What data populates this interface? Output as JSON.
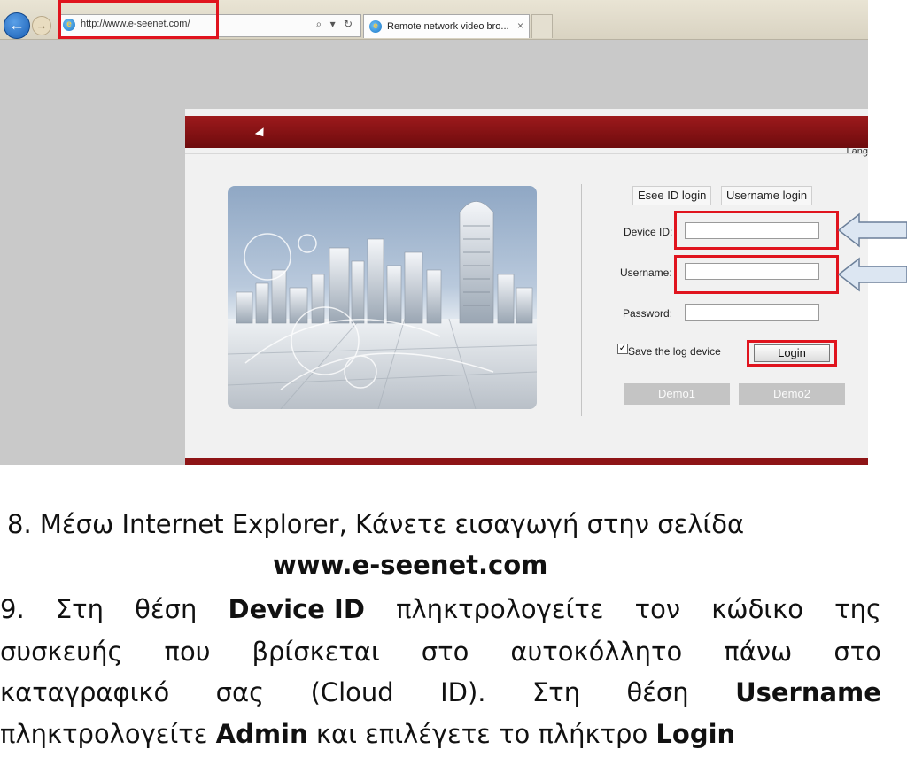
{
  "browser": {
    "url": "http://www.e-seenet.com/",
    "tab_title": "Remote network video bro...",
    "tab_close": "×",
    "back_icon": "back-arrow-icon",
    "forward_icon": "forward-arrow-icon",
    "addr_tools": "⌕ ▾ ↻"
  },
  "page": {
    "language_label": "Lang",
    "tabs": [
      "Esee ID login",
      "Username login"
    ],
    "fields": {
      "device_id_label": "Device ID:",
      "username_label": "Username:",
      "password_label": "Password:",
      "device_id_value": "",
      "username_value": "",
      "password_value": ""
    },
    "save_label": "Save the log device",
    "save_checked": true,
    "login_label": "Login",
    "demo1_label": "Demo1",
    "demo2_label": "Demo2",
    "colors": {
      "header": "#8e1416",
      "highlight": "#e0141e",
      "arrow": "#dce6f2"
    }
  },
  "instructions": {
    "step8_line1": "8. Μέσω Internet Explorer, Κάνετε εισαγωγή στην σελίδα",
    "step8_url": "www.e-seenet.com",
    "step9_line1": [
      "9.",
      "Στη",
      "θέση",
      "Device ID",
      "πληκτρολογείτε",
      "τον",
      "κώδικο",
      "της"
    ],
    "step9_line2": [
      "συσκευής",
      "που",
      "βρίσκεται",
      "στο",
      "αυτοκόλλητο",
      "πάνω",
      "στο"
    ],
    "step9_line3": [
      "καταγραφικό",
      "σας",
      "(Cloud",
      "ID).",
      "Στη",
      "θέση",
      "Username"
    ],
    "step9_line4_a": "πληκτρολογείτε ",
    "step9_line4_b": "Admin",
    "step9_line4_c": " και επιλέγετε το πλήκτρο ",
    "step9_line4_d": "Login"
  }
}
